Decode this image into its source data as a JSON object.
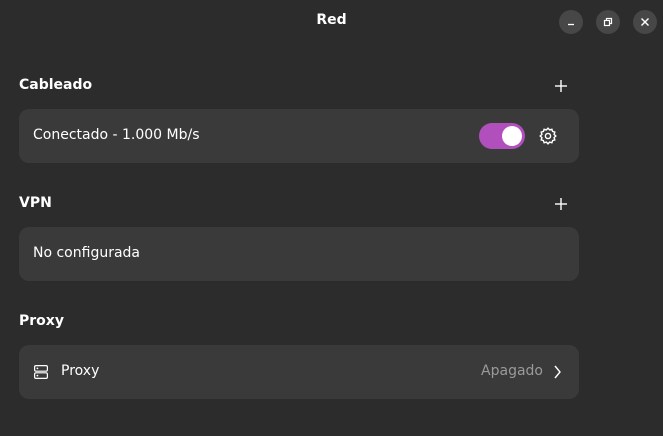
{
  "window": {
    "title": "Red"
  },
  "wired": {
    "heading": "Cableado",
    "connection_label": "Conectado - 1.000 Mb/s",
    "switch_on": true
  },
  "vpn": {
    "heading": "VPN",
    "status_label": "No configurada"
  },
  "proxy": {
    "heading": "Proxy",
    "row_label": "Proxy",
    "status": "Apagado"
  },
  "colors": {
    "accent": "#b14fbd",
    "background": "#2c2c2c",
    "card": "#3a3a3a"
  },
  "icons": {
    "minimize": "minimize-icon",
    "maximize": "maximize-icon",
    "close": "close-icon",
    "add": "plus-icon",
    "settings": "gear-icon",
    "proxy": "network-server-icon",
    "chevron": "chevron-right-icon"
  }
}
